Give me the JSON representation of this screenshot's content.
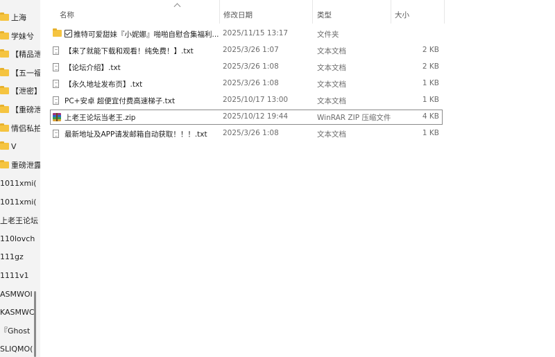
{
  "nav": {
    "items": [
      {
        "label": "上海",
        "icon": "folder-icon"
      },
      {
        "label": "学妹兮",
        "icon": "folder-icon"
      },
      {
        "label": "【精品泄",
        "icon": "folder-icon"
      },
      {
        "label": "【五一福",
        "icon": "folder-icon"
      },
      {
        "label": "【泄密】",
        "icon": "folder-icon"
      },
      {
        "label": "【重磅泄",
        "icon": "folder-icon"
      },
      {
        "label": "情侣私拍",
        "icon": "folder-icon"
      },
      {
        "label": "V",
        "icon": "folder-icon"
      },
      {
        "label": "重磅泄露",
        "icon": "folder-icon"
      },
      {
        "label": "1011xmi(",
        "icon": ""
      },
      {
        "label": "1011xmi(",
        "icon": ""
      },
      {
        "label": "上老王论坛",
        "icon": ""
      },
      {
        "label": "110lovch",
        "icon": ""
      },
      {
        "label": "111gz",
        "icon": ""
      },
      {
        "label": "1111v1",
        "icon": ""
      },
      {
        "label": "ASMWOI",
        "icon": ""
      },
      {
        "label": "KASMWC",
        "icon": ""
      },
      {
        "label": "『Ghost",
        "icon": ""
      },
      {
        "label": "SLIQMO(",
        "icon": ""
      }
    ]
  },
  "columns": {
    "name": "名称",
    "date": "修改日期",
    "type": "类型",
    "size": "大小"
  },
  "files": [
    {
      "kind": "folder",
      "name": "推特可爱甜妹『小妮娜』啪啪自慰合集福利...",
      "has_check": true,
      "date": "2025/11/15 13:17",
      "type": "文件夹",
      "size": ""
    },
    {
      "kind": "txt",
      "name": "【来了就能下载和观看！纯免费！】.txt",
      "date": "2025/3/26 1:07",
      "type": "文本文档",
      "size": "2 KB"
    },
    {
      "kind": "txt",
      "name": "【论坛介绍】.txt",
      "date": "2025/3/26 1:08",
      "type": "文本文档",
      "size": "2 KB"
    },
    {
      "kind": "txt",
      "name": "【永久地址发布页】.txt",
      "date": "2025/3/26 1:08",
      "type": "文本文档",
      "size": "1 KB"
    },
    {
      "kind": "txt",
      "name": "PC+安卓 超便宜付费高速梯子.txt",
      "date": "2025/10/17 13:00",
      "type": "文本文档",
      "size": "1 KB"
    },
    {
      "kind": "zip",
      "name": "上老王论坛当老王.zip",
      "date": "2025/10/12 19:44",
      "type": "WinRAR ZIP 压缩文件",
      "size": "4 KB",
      "selected": true
    },
    {
      "kind": "txt",
      "name": "最新地址及APP请发邮箱自动获取！！！.txt",
      "date": "2025/3/26 1:08",
      "type": "文本文档",
      "size": "1 KB"
    }
  ]
}
